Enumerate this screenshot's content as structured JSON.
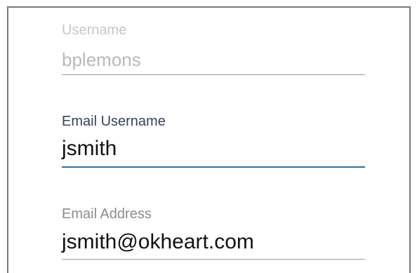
{
  "form": {
    "fields": [
      {
        "label": "Username",
        "value": "bplemons",
        "state": "disabled"
      },
      {
        "label": "Email Username",
        "value": "jsmith",
        "state": "focused"
      },
      {
        "label": "Email Address",
        "value": "jsmith@okheart.com",
        "state": "normal"
      }
    ]
  },
  "colors": {
    "border": "#7a7a7a",
    "disabled_text": "#b9b9b9",
    "focused_label": "#33445a",
    "focused_underline": "#2a73a8",
    "label": "#8c8c8c",
    "value_text": "#111111"
  }
}
